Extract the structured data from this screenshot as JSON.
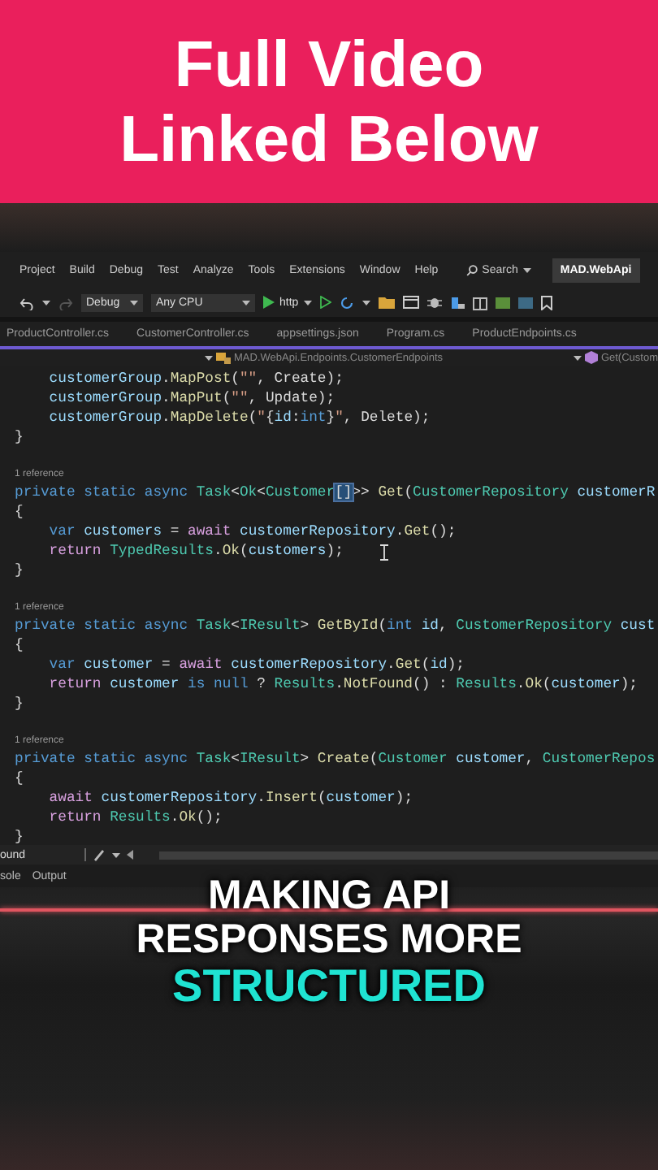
{
  "banner": {
    "lines": [
      "Full Video",
      "Linked Below"
    ]
  },
  "menu_bar": {
    "items": [
      "Project",
      "Build",
      "Debug",
      "Test",
      "Analyze",
      "Tools",
      "Extensions",
      "Window",
      "Help"
    ],
    "search": "Search",
    "solution": "MAD.WebApi"
  },
  "toolbar": {
    "configuration": "Debug",
    "platform": "Any CPU",
    "run_target": "http"
  },
  "tabs": [
    {
      "label": "ProductController.cs",
      "selected": false
    },
    {
      "label": "CustomerController.cs",
      "selected": false
    },
    {
      "label": "appsettings.json",
      "selected": false
    },
    {
      "label": "Program.cs",
      "selected": false
    },
    {
      "label": "ProductEndpoints.cs",
      "selected": false
    }
  ],
  "navigation_bar": {
    "type_path": "MAD.WebApi.Endpoints.CustomerEndpoints",
    "member": "Get(Custom"
  },
  "code_lines": [
    {
      "kind": "code",
      "indented": true,
      "tokens": [
        {
          "kind": "var",
          "text": "customerGroup"
        },
        {
          "kind": "pl",
          "text": "."
        },
        {
          "kind": "fn",
          "text": "MapPost"
        },
        {
          "kind": "pl",
          "text": "("
        },
        {
          "kind": "str",
          "text": "\"\""
        },
        {
          "kind": "pl",
          "text": ", Create);"
        }
      ]
    },
    {
      "kind": "code",
      "indented": true,
      "tokens": [
        {
          "kind": "var",
          "text": "customerGroup"
        },
        {
          "kind": "pl",
          "text": "."
        },
        {
          "kind": "fn",
          "text": "MapPut"
        },
        {
          "kind": "pl",
          "text": "("
        },
        {
          "kind": "str",
          "text": "\"\""
        },
        {
          "kind": "pl",
          "text": ", Update);"
        }
      ]
    },
    {
      "kind": "code",
      "indented": true,
      "tokens": [
        {
          "kind": "var",
          "text": "customerGroup"
        },
        {
          "kind": "pl",
          "text": "."
        },
        {
          "kind": "fn",
          "text": "MapDelete"
        },
        {
          "kind": "pl",
          "text": "("
        },
        {
          "kind": "str",
          "text": "\""
        },
        {
          "kind": "pl",
          "text": "{"
        },
        {
          "kind": "var",
          "text": "id"
        },
        {
          "kind": "pl",
          "text": ":"
        },
        {
          "kind": "kw",
          "text": "int"
        },
        {
          "kind": "pl",
          "text": "}"
        },
        {
          "kind": "str",
          "text": "\""
        },
        {
          "kind": "pl",
          "text": ", Delete);"
        }
      ]
    },
    {
      "kind": "code",
      "indented": false,
      "tokens": [
        {
          "kind": "pl",
          "text": "}"
        }
      ]
    },
    {
      "kind": "blank"
    },
    {
      "kind": "reference",
      "text": "1 reference"
    },
    {
      "kind": "code",
      "indented": false,
      "tokens": [
        {
          "kind": "kw",
          "text": "private static async "
        },
        {
          "kind": "type",
          "text": "Task"
        },
        {
          "kind": "pl",
          "text": "<"
        },
        {
          "kind": "type",
          "text": "Ok"
        },
        {
          "kind": "pl",
          "text": "<"
        },
        {
          "kind": "type",
          "text": "Customer"
        },
        {
          "kind": "match",
          "text": "[]"
        },
        {
          "kind": "pl",
          "text": ">> "
        },
        {
          "kind": "fn",
          "text": "Get"
        },
        {
          "kind": "pl",
          "text": "("
        },
        {
          "kind": "type",
          "text": "CustomerRepository "
        },
        {
          "kind": "var",
          "text": "customerR"
        }
      ]
    },
    {
      "kind": "code",
      "indented": false,
      "tokens": [
        {
          "kind": "pl",
          "text": "{"
        }
      ]
    },
    {
      "kind": "code",
      "indented": true,
      "tokens": [
        {
          "kind": "kw",
          "text": "var "
        },
        {
          "kind": "var",
          "text": "customers"
        },
        {
          "kind": "pl",
          "text": " = "
        },
        {
          "kind": "ctl",
          "text": "await "
        },
        {
          "kind": "var",
          "text": "customerRepository"
        },
        {
          "kind": "pl",
          "text": "."
        },
        {
          "kind": "fn",
          "text": "Get"
        },
        {
          "kind": "pl",
          "text": "();"
        }
      ]
    },
    {
      "kind": "code",
      "indented": true,
      "tokens": [
        {
          "kind": "ctl",
          "text": "return "
        },
        {
          "kind": "type",
          "text": "TypedResults"
        },
        {
          "kind": "pl",
          "text": "."
        },
        {
          "kind": "fn",
          "text": "Ok"
        },
        {
          "kind": "pl",
          "text": "("
        },
        {
          "kind": "var",
          "text": "customers"
        },
        {
          "kind": "pl",
          "text": ");"
        }
      ]
    },
    {
      "kind": "code",
      "indented": false,
      "tokens": [
        {
          "kind": "pl",
          "text": "}"
        }
      ]
    },
    {
      "kind": "blank"
    },
    {
      "kind": "reference",
      "text": "1 reference"
    },
    {
      "kind": "code",
      "indented": false,
      "tokens": [
        {
          "kind": "kw",
          "text": "private static async "
        },
        {
          "kind": "type",
          "text": "Task"
        },
        {
          "kind": "pl",
          "text": "<"
        },
        {
          "kind": "type",
          "text": "IResult"
        },
        {
          "kind": "pl",
          "text": "> "
        },
        {
          "kind": "fn",
          "text": "GetById"
        },
        {
          "kind": "pl",
          "text": "("
        },
        {
          "kind": "kw",
          "text": "int "
        },
        {
          "kind": "var",
          "text": "id"
        },
        {
          "kind": "pl",
          "text": ", "
        },
        {
          "kind": "type",
          "text": "CustomerRepository "
        },
        {
          "kind": "var",
          "text": "cust"
        }
      ]
    },
    {
      "kind": "code",
      "indented": false,
      "tokens": [
        {
          "kind": "pl",
          "text": "{"
        }
      ]
    },
    {
      "kind": "code",
      "indented": true,
      "tokens": [
        {
          "kind": "kw",
          "text": "var "
        },
        {
          "kind": "var",
          "text": "customer"
        },
        {
          "kind": "pl",
          "text": " = "
        },
        {
          "kind": "ctl",
          "text": "await "
        },
        {
          "kind": "var",
          "text": "customerRepository"
        },
        {
          "kind": "pl",
          "text": "."
        },
        {
          "kind": "fn",
          "text": "Get"
        },
        {
          "kind": "pl",
          "text": "("
        },
        {
          "kind": "var",
          "text": "id"
        },
        {
          "kind": "pl",
          "text": ");"
        }
      ]
    },
    {
      "kind": "code",
      "indented": true,
      "tokens": [
        {
          "kind": "ctl",
          "text": "return "
        },
        {
          "kind": "var",
          "text": "customer "
        },
        {
          "kind": "kw",
          "text": "is null"
        },
        {
          "kind": "pl",
          "text": " ? "
        },
        {
          "kind": "type",
          "text": "Results"
        },
        {
          "kind": "pl",
          "text": "."
        },
        {
          "kind": "fn",
          "text": "NotFound"
        },
        {
          "kind": "pl",
          "text": "() : "
        },
        {
          "kind": "type",
          "text": "Results"
        },
        {
          "kind": "pl",
          "text": "."
        },
        {
          "kind": "fn",
          "text": "Ok"
        },
        {
          "kind": "pl",
          "text": "("
        },
        {
          "kind": "var",
          "text": "customer"
        },
        {
          "kind": "pl",
          "text": ");"
        }
      ]
    },
    {
      "kind": "code",
      "indented": false,
      "tokens": [
        {
          "kind": "pl",
          "text": "}"
        }
      ]
    },
    {
      "kind": "blank"
    },
    {
      "kind": "reference",
      "text": "1 reference"
    },
    {
      "kind": "code",
      "indented": false,
      "tokens": [
        {
          "kind": "kw",
          "text": "private static async "
        },
        {
          "kind": "type",
          "text": "Task"
        },
        {
          "kind": "pl",
          "text": "<"
        },
        {
          "kind": "type",
          "text": "IResult"
        },
        {
          "kind": "pl",
          "text": "> "
        },
        {
          "kind": "fn",
          "text": "Create"
        },
        {
          "kind": "pl",
          "text": "("
        },
        {
          "kind": "type",
          "text": "Customer "
        },
        {
          "kind": "var",
          "text": "customer"
        },
        {
          "kind": "pl",
          "text": ", "
        },
        {
          "kind": "type",
          "text": "CustomerRepos"
        }
      ]
    },
    {
      "kind": "code",
      "indented": false,
      "tokens": [
        {
          "kind": "pl",
          "text": "{"
        }
      ]
    },
    {
      "kind": "code",
      "indented": true,
      "tokens": [
        {
          "kind": "ctl",
          "text": "await "
        },
        {
          "kind": "var",
          "text": "customerRepository"
        },
        {
          "kind": "pl",
          "text": "."
        },
        {
          "kind": "fn",
          "text": "Insert"
        },
        {
          "kind": "pl",
          "text": "("
        },
        {
          "kind": "var",
          "text": "customer"
        },
        {
          "kind": "pl",
          "text": ");"
        }
      ]
    },
    {
      "kind": "code",
      "indented": true,
      "tokens": [
        {
          "kind": "ctl",
          "text": "return "
        },
        {
          "kind": "type",
          "text": "Results"
        },
        {
          "kind": "pl",
          "text": "."
        },
        {
          "kind": "fn",
          "text": "Ok"
        },
        {
          "kind": "pl",
          "text": "();"
        }
      ]
    },
    {
      "kind": "code",
      "indented": false,
      "tokens": [
        {
          "kind": "pl",
          "text": "}"
        }
      ]
    }
  ],
  "status_bar": {
    "text": "ound"
  },
  "bottom_tabs": [
    "sole",
    "Output"
  ],
  "caption": [
    {
      "text": "MAKING API",
      "highlight": false
    },
    {
      "text": "RESPONSES MORE",
      "highlight": false
    },
    {
      "text": "STRUCTURED",
      "highlight": true
    }
  ]
}
